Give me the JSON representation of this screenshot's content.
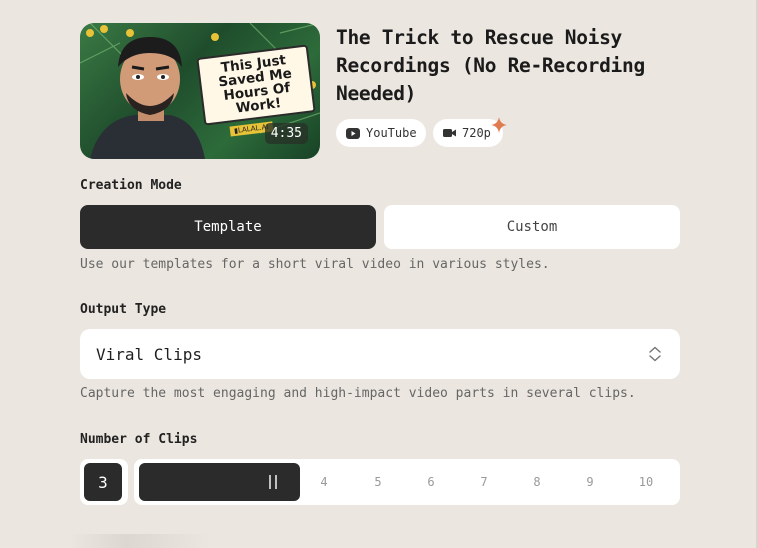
{
  "video": {
    "title": "The Trick to Rescue Noisy Recordings (No Re-Recording Needed)",
    "thumbnail_text": "This Just\nSaved Me\nHours Of Work!",
    "thumbnail_tag": "▮LALAL.AI",
    "duration": "4:35",
    "source_label": "YouTube",
    "source_icon": "youtube-icon",
    "resolution_label": "720p",
    "resolution_icon": "video-camera-icon",
    "accent_color": "#e07a4f"
  },
  "creation_mode": {
    "label": "Creation Mode",
    "options": [
      "Template",
      "Custom"
    ],
    "selected": "Template",
    "helper": "Use our templates for a short viral video in various styles."
  },
  "output_type": {
    "label": "Output Type",
    "value": "Viral Clips",
    "helper": "Capture the most engaging and high-impact video parts in several clips."
  },
  "clips": {
    "label": "Number of Clips",
    "value": "3",
    "ticks": [
      "4",
      "5",
      "6",
      "7",
      "8",
      "9",
      "10"
    ],
    "min": 1,
    "max": 10
  }
}
